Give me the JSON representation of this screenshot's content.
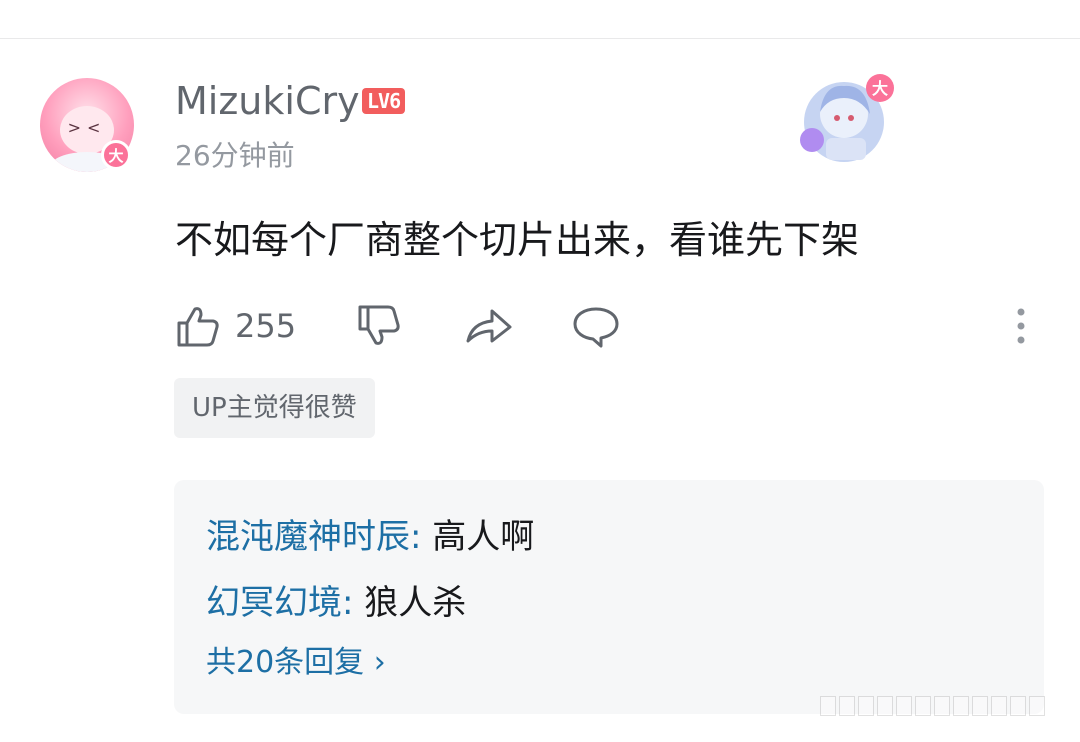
{
  "comment": {
    "username": "MizukiCry",
    "level": "LV6",
    "time": "26分钟前",
    "avatar_badge": "大",
    "decoration_badge": "大",
    "content": "不如每个厂商整个切片出来，看谁先下架",
    "like_count": "255",
    "tag": "UP主觉得很赞"
  },
  "replies": {
    "items": [
      {
        "name": "混沌魔神时辰",
        "sep": ": ",
        "text": "高人啊"
      },
      {
        "name": "幻冥幻境",
        "sep": ": ",
        "text": "狼人杀"
      }
    ],
    "more_label": "共20条回复 ›"
  },
  "colors": {
    "accent_pink": "#fb7299",
    "level_red": "#f25d5d",
    "link_blue": "#1d6fa5",
    "muted_text": "#9499a0"
  },
  "icons": [
    "thumbs-up-icon",
    "thumbs-down-icon",
    "share-icon",
    "comment-icon",
    "more-vertical-icon"
  ]
}
